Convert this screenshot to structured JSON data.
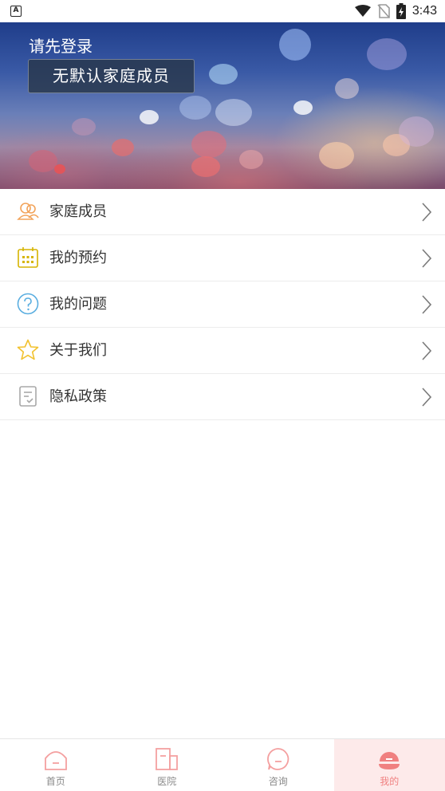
{
  "status_bar": {
    "time": "3:43",
    "left_icon_letter": "A"
  },
  "header": {
    "login_prompt": "请先登录",
    "default_member": "无默认家庭成员"
  },
  "menu": {
    "items": [
      {
        "label": "家庭成员",
        "icon": "family-members-icon",
        "color": "#f2a35a"
      },
      {
        "label": "我的预约",
        "icon": "calendar-icon",
        "color": "#d6b400"
      },
      {
        "label": "我的问题",
        "icon": "question-icon",
        "color": "#5aaee0"
      },
      {
        "label": "关于我们",
        "icon": "star-icon",
        "color": "#f2c230"
      },
      {
        "label": "隐私政策",
        "icon": "document-icon",
        "color": "#a8a8a8"
      }
    ]
  },
  "bottom_nav": {
    "items": [
      {
        "label": "首页",
        "icon": "home-icon"
      },
      {
        "label": "医院",
        "icon": "hospital-icon"
      },
      {
        "label": "咨询",
        "icon": "chat-icon"
      },
      {
        "label": "我的",
        "icon": "profile-icon",
        "active": true
      }
    ],
    "accent": "#f08080"
  }
}
